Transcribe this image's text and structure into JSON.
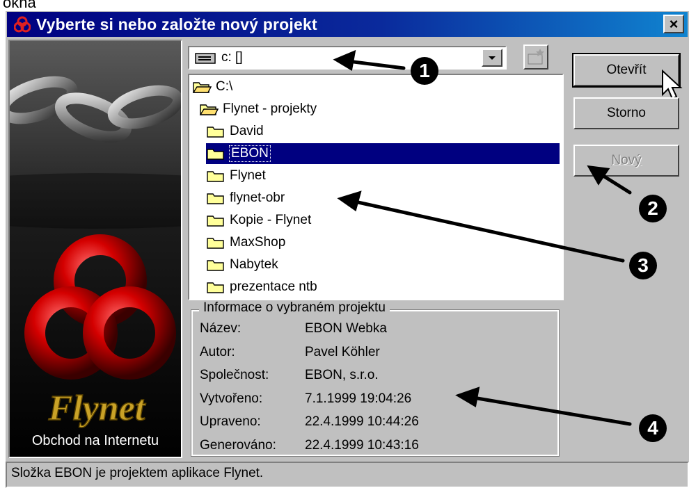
{
  "caption": "okna",
  "window": {
    "title": "Vyberte si nebo založte nový projekt",
    "close_label": "×"
  },
  "logo": {
    "brand": "Flynet",
    "tagline": "Obchod na Internetu"
  },
  "drive_combo": {
    "value": "c: []"
  },
  "folders": [
    {
      "label": "C:\\",
      "kind": "open-folder",
      "indent": 0,
      "selected": false
    },
    {
      "label": "Flynet - projekty",
      "kind": "open-folder",
      "indent": 1,
      "selected": false
    },
    {
      "label": "David",
      "kind": "folder",
      "indent": 2,
      "selected": false
    },
    {
      "label": "EBON",
      "kind": "folder",
      "indent": 2,
      "selected": true
    },
    {
      "label": "Flynet",
      "kind": "folder",
      "indent": 2,
      "selected": false
    },
    {
      "label": "flynet-obr",
      "kind": "folder",
      "indent": 2,
      "selected": false
    },
    {
      "label": "Kopie - Flynet",
      "kind": "folder",
      "indent": 2,
      "selected": false
    },
    {
      "label": "MaxShop",
      "kind": "folder",
      "indent": 2,
      "selected": false
    },
    {
      "label": "Nabytek",
      "kind": "folder",
      "indent": 2,
      "selected": false
    },
    {
      "label": "prezentace ntb",
      "kind": "folder",
      "indent": 2,
      "selected": false
    }
  ],
  "info": {
    "legend": "Informace o vybraném projektu",
    "rows": [
      {
        "label": "Název:",
        "value": "EBON Webka"
      },
      {
        "label": "Autor:",
        "value": "Pavel Köhler"
      },
      {
        "label": "Společnost:",
        "value": "EBON, s.r.o."
      },
      {
        "label": "Vytvořeno:",
        "value": "7.1.1999 19:04:26"
      },
      {
        "label": "Upraveno:",
        "value": "22.4.1999 10:44:26"
      },
      {
        "label": "Generováno:",
        "value": "22.4.1999 10:43:16"
      }
    ]
  },
  "buttons": {
    "open": "Otevřít",
    "cancel": "Storno",
    "new": "Nový"
  },
  "callouts": [
    "1",
    "2",
    "3",
    "4"
  ],
  "status": "Složka EBON je projektem aplikace Flynet.",
  "colors": {
    "face": "#c0c0c0",
    "title_start": "#000080",
    "title_end": "#1084d0",
    "selection": "#000080",
    "ring": "#d40000",
    "brand_gold": "#c9a227"
  },
  "icons": [
    "app-icon",
    "close-icon",
    "drive-icon",
    "dropdown-arrow-icon",
    "new-folder-icon",
    "open-folder-icon",
    "folder-icon",
    "mouse-cursor-icon"
  ]
}
